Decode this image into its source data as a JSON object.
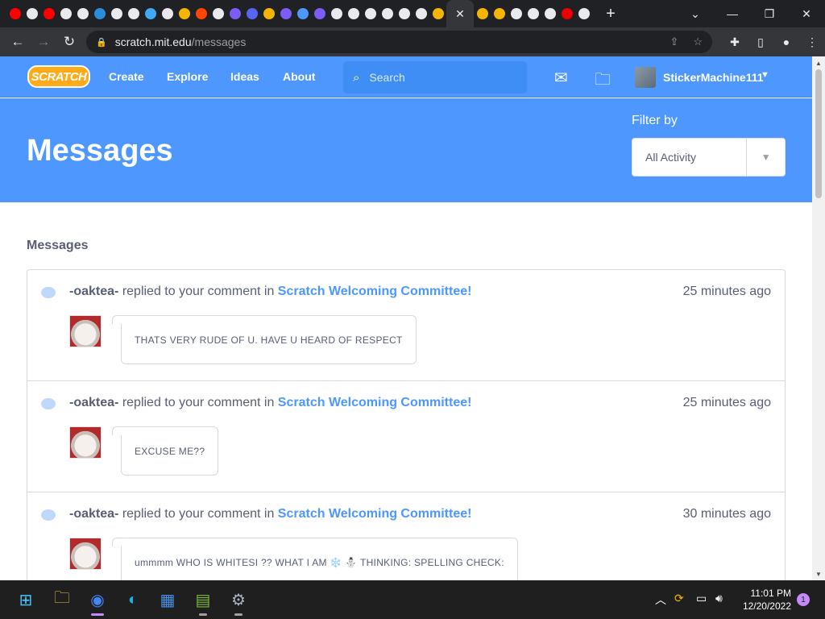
{
  "browser": {
    "address_host": "scratch.mit.edu",
    "address_path": "/messages",
    "tab_favicon_colors": [
      "#ff0000",
      "#e8eaed",
      "#ff0000",
      "#e8eaed",
      "#e8eaed",
      "#2b8dd8",
      "#e8eaed",
      "#e8eaed",
      "#3fa9f5",
      "#e8eaed",
      "#f6b600",
      "#ff4500",
      "#e8eaed",
      "#7b5cf5",
      "#5865f2",
      "#f4b400",
      "#7b5cf5",
      "#4d97ff",
      "#7b5cf5",
      "#e8eaed",
      "#e8eaed",
      "#e8eaed",
      "#e8eaed",
      "#e8eaed",
      "#e8eaed",
      "#f4b400"
    ],
    "tab_favicon_colors_after": [
      "#f4b400",
      "#f4b400",
      "#e8eaed",
      "#e8eaed",
      "#e8eaed",
      "#e00",
      "#e8eaed"
    ]
  },
  "nav": {
    "logo": "SCRATCH",
    "create": "Create",
    "explore": "Explore",
    "ideas": "Ideas",
    "about": "About",
    "search_placeholder": "Search",
    "username": "StickerMachine111"
  },
  "hero": {
    "title": "Messages",
    "filter_label": "Filter by",
    "filter_value": "All Activity"
  },
  "section_title": "Messages",
  "messages": [
    {
      "user": "-oaktea-",
      "action": "replied to your comment in",
      "project": "Scratch Welcoming Committee!",
      "time": "25 minutes ago",
      "comment": "THATS VERY RUDE OF U. HAVE U HEARD OF RESPECT"
    },
    {
      "user": "-oaktea-",
      "action": "replied to your comment in",
      "project": "Scratch Welcoming Committee!",
      "time": "25 minutes ago",
      "comment": "EXCUSE ME??"
    },
    {
      "user": "-oaktea-",
      "action": "replied to your comment in",
      "project": "Scratch Welcoming Committee!",
      "time": "30 minutes ago",
      "comment": "ummmm WHO IS WHITESI ?? WHAT I AM ❄️ ⛄ THINKING: SPELLING CHECK:"
    }
  ],
  "taskbar": {
    "time": "11:01 PM",
    "date": "12/20/2022",
    "notifications": "1"
  }
}
